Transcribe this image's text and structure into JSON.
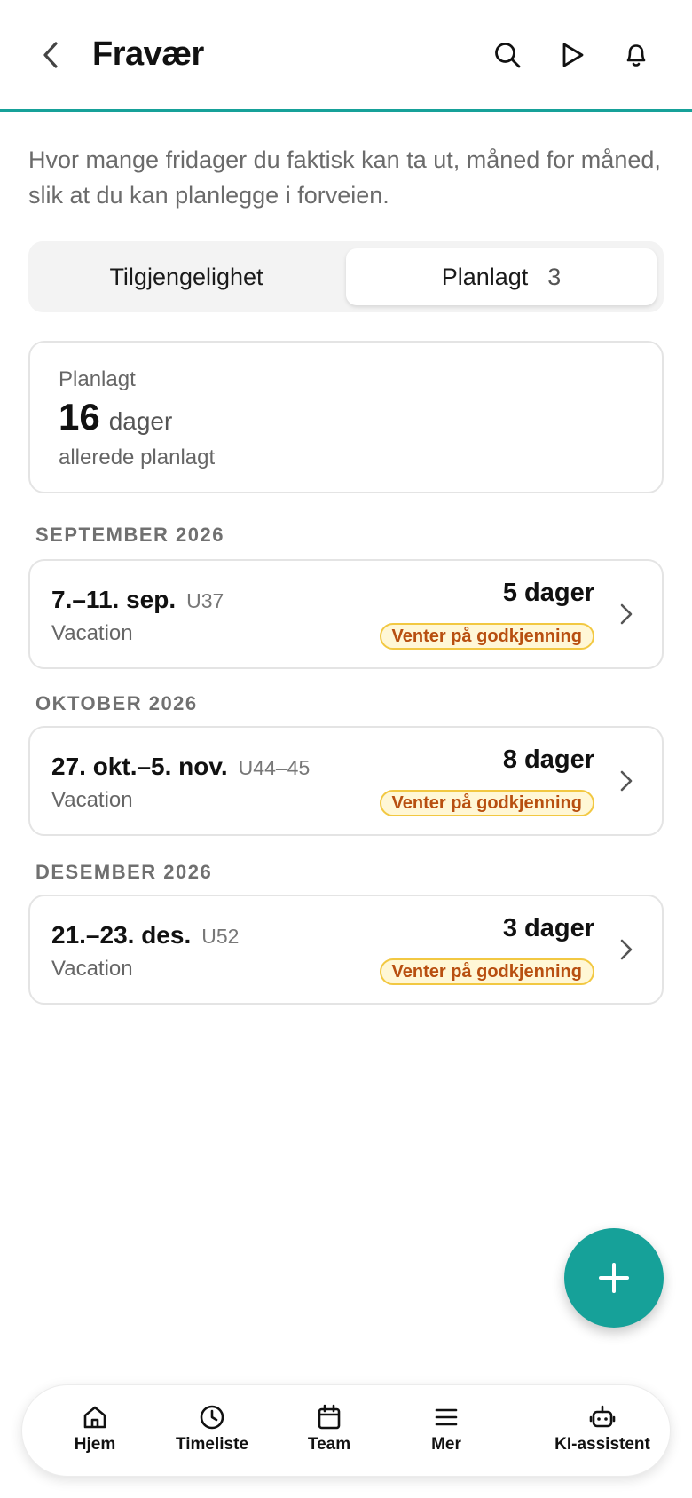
{
  "header": {
    "title": "Fravær",
    "back_icon": "chevron-left-icon",
    "actions": [
      "search-icon",
      "play-icon",
      "bell-icon"
    ]
  },
  "intro": "Hvor mange fridager du faktisk kan ta ut, måned for måned, slik at du kan planlegge i forveien.",
  "segments": {
    "available_label": "Tilgjengelighet",
    "planned_label": "Planlagt",
    "planned_count": "3",
    "selected": "Planlagt"
  },
  "summary": {
    "label": "Planlagt",
    "value": "16",
    "unit": "dager",
    "sub": "allerede planlagt"
  },
  "groups": [
    {
      "month": "SEPTEMBER 2026",
      "item": {
        "date": "7.–11. sep.",
        "week": "U37",
        "type": "Vacation",
        "days": "5 dager",
        "status": "Venter på godkjenning"
      }
    },
    {
      "month": "OKTOBER 2026",
      "item": {
        "date": "27. okt.–5. nov.",
        "week": "U44–45",
        "type": "Vacation",
        "days": "8 dager",
        "status": "Venter på godkjenning"
      }
    },
    {
      "month": "DESEMBER 2026",
      "item": {
        "date": "21.–23. des.",
        "week": "U52",
        "type": "Vacation",
        "days": "3 dager",
        "status": "Venter på godkjenning"
      }
    }
  ],
  "fab_icon": "plus-icon",
  "nav": [
    {
      "label": "Hjem",
      "icon": "home-icon"
    },
    {
      "label": "Timeliste",
      "icon": "clock-icon"
    },
    {
      "label": "Team",
      "icon": "calendar-icon"
    },
    {
      "label": "Mer",
      "icon": "menu-icon"
    },
    {
      "label": "KI-assistent",
      "icon": "robot-icon"
    }
  ],
  "colors": {
    "accent": "#16a199",
    "badge_text": "#b84f10",
    "badge_border": "#f2c842",
    "badge_bg": "#fff7d6"
  }
}
